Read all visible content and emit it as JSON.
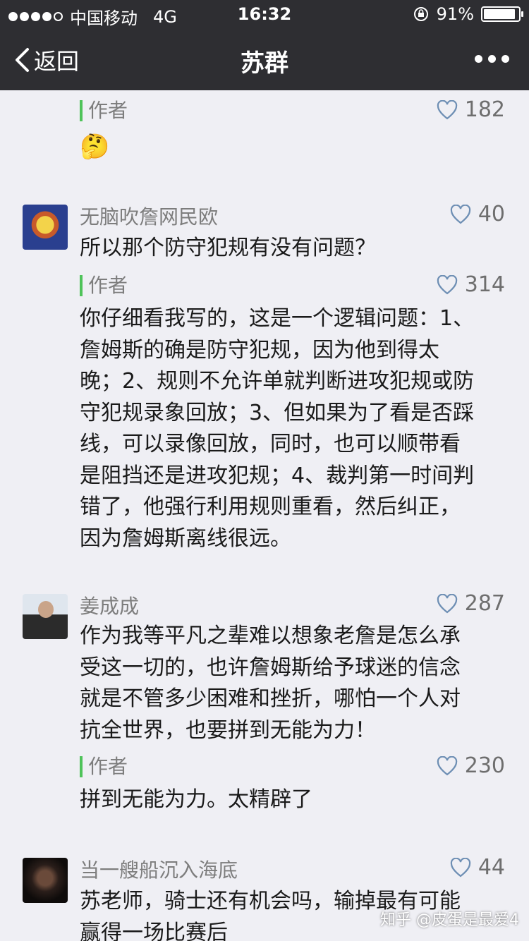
{
  "status_bar": {
    "carrier": "中国移动",
    "network": "4G",
    "time": "16:32",
    "battery": "91%",
    "battery_level": 0.91
  },
  "nav": {
    "back_label": "返回",
    "title": "苏群"
  },
  "comments": [
    {
      "reply": {
        "author_label": "作者",
        "likes": "182",
        "text": "🤔"
      }
    },
    {
      "name": "无脑吹詹网民欧",
      "likes": "40",
      "text": "所以那个防守犯规有没有问题？",
      "reply": {
        "author_label": "作者",
        "likes": "314",
        "lines": [
          "你仔细看我写的，这是一个逻辑问题：1、",
          "詹姆斯的确是防守犯规，因为他到得太",
          "晚；2、规则不允许单就判断进攻犯规或防",
          "守犯规录象回放；3、但如果为了看是否踩",
          "线，可以录像回放，同时，也可以顺带看",
          "是阻挡还是进攻犯规；4、裁判第一时间判",
          "错了，他强行利用规则重看，然后纠正，",
          "因为詹姆斯离线很远。"
        ]
      }
    },
    {
      "name": "姜成成",
      "likes": "287",
      "lines": [
        "作为我等平凡之辈难以想象老詹是怎么承",
        "受这一切的，也许詹姆斯给予球迷的信念",
        "就是不管多少困难和挫折，哪怕一个人对",
        "抗全世界，也要拼到无能为力！"
      ],
      "reply": {
        "author_label": "作者",
        "likes": "230",
        "text": "拼到无能为力。太精辟了"
      }
    },
    {
      "name": "当一艘船沉入海底",
      "likes": "44",
      "lines": [
        "苏老师，骑士还有机会吗，输掉最有可能",
        "赢得一场比赛后"
      ]
    }
  ],
  "watermark": "知乎 @皮蛋是最爱4"
}
